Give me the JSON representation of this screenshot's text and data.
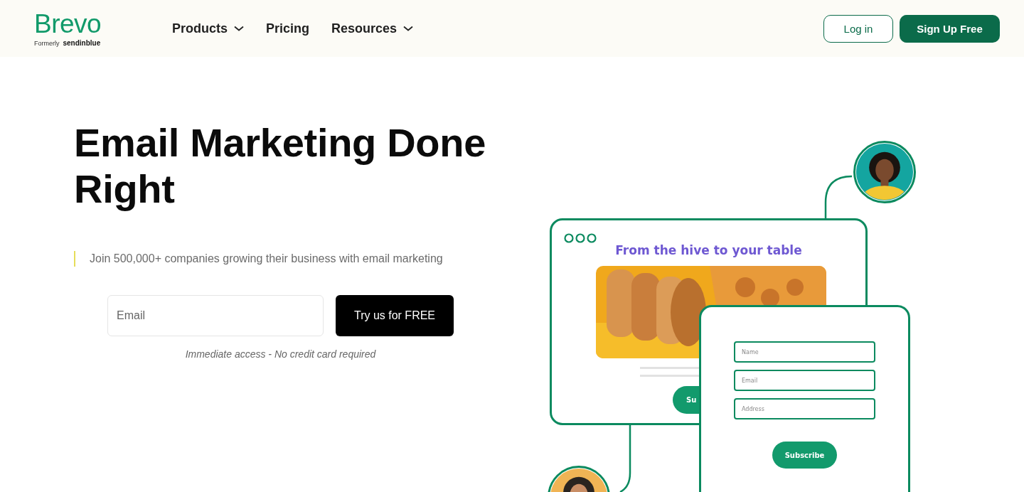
{
  "header": {
    "logo": "Brevo",
    "tagline_prefix": "Formerly",
    "tagline_brand": "sendinblue",
    "nav": [
      {
        "label": "Products",
        "has_menu": true
      },
      {
        "label": "Pricing",
        "has_menu": false
      },
      {
        "label": "Resources",
        "has_menu": true
      }
    ],
    "login": "Log in",
    "signup": "Sign Up Free"
  },
  "hero": {
    "title": "Email Marketing Done Right",
    "subtitle": "Join 500,000+ companies growing their business with email marketing",
    "email_placeholder": "Email",
    "cta": "Try us for FREE",
    "note": "Immediate access - No credit card required"
  },
  "illustration": {
    "newsletter": {
      "heading": "From the hive to your table",
      "button": "Su"
    },
    "form": {
      "fields": [
        {
          "placeholder": "Name"
        },
        {
          "placeholder": "Email"
        },
        {
          "placeholder": "Address"
        }
      ],
      "button": "Subscribe"
    }
  }
}
